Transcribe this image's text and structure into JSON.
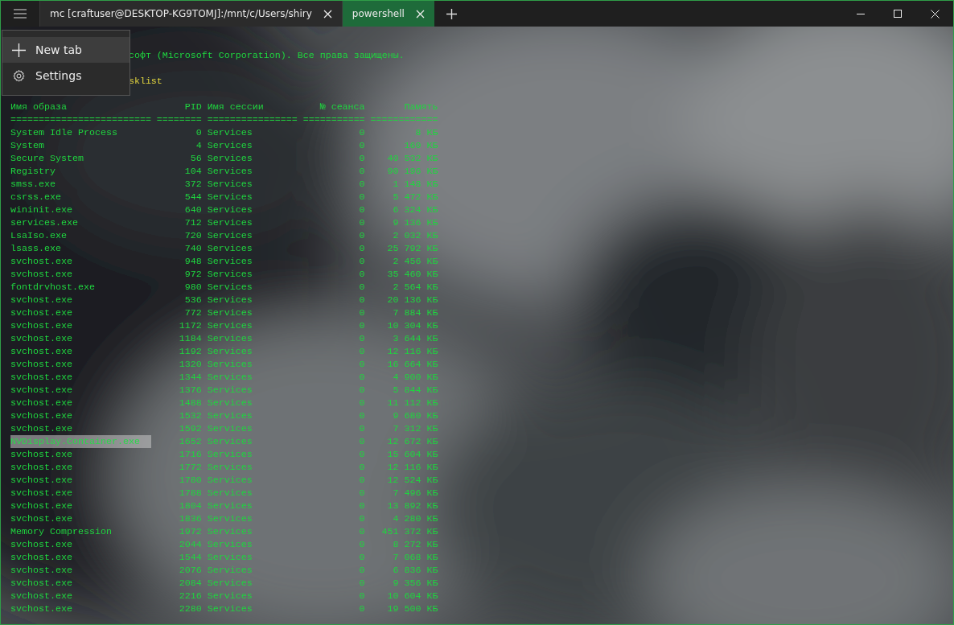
{
  "tabs": [
    {
      "title": "mc [craftuser@DESKTOP-KG9TOMJ]:/mnt/c/Users/shiry",
      "selected": false
    },
    {
      "title": "powershell",
      "selected": true
    }
  ],
  "menu": {
    "items": [
      {
        "label": "New tab",
        "kind": "new",
        "selected": true
      },
      {
        "label": "Settings",
        "kind": "settings",
        "selected": false
      }
    ]
  },
  "terminal": {
    "lines": [
      {
        "text": "софт (Microsoft Corporation). Все права защищены.",
        "kind": "output"
      },
      {
        "text": "sklist",
        "kind": "command"
      }
    ],
    "columns": [
      "Имя образа",
      "PID",
      "Имя сессии",
      "№ сеанса",
      "Память"
    ],
    "separators": [
      "=========================",
      "========",
      "================",
      "===========",
      "============"
    ],
    "rows": [
      {
        "name": "System Idle Process",
        "pid": "0",
        "session": "Services",
        "session_no": "0",
        "memory": "8 КБ",
        "selected": false
      },
      {
        "name": "System",
        "pid": "4",
        "session": "Services",
        "session_no": "0",
        "memory": "160 КБ",
        "selected": false
      },
      {
        "name": "Secure System",
        "pid": "56",
        "session": "Services",
        "session_no": "0",
        "memory": "40 532 КБ",
        "selected": false
      },
      {
        "name": "Registry",
        "pid": "104",
        "session": "Services",
        "session_no": "0",
        "memory": "90 196 КБ",
        "selected": false
      },
      {
        "name": "smss.exe",
        "pid": "372",
        "session": "Services",
        "session_no": "0",
        "memory": "1 148 КБ",
        "selected": false
      },
      {
        "name": "csrss.exe",
        "pid": "544",
        "session": "Services",
        "session_no": "0",
        "memory": "5 472 КБ",
        "selected": false
      },
      {
        "name": "wininit.exe",
        "pid": "640",
        "session": "Services",
        "session_no": "0",
        "memory": "6 324 КБ",
        "selected": false
      },
      {
        "name": "services.exe",
        "pid": "712",
        "session": "Services",
        "session_no": "0",
        "memory": "9 136 КБ",
        "selected": false
      },
      {
        "name": "LsaIso.exe",
        "pid": "720",
        "session": "Services",
        "session_no": "0",
        "memory": "2 032 КБ",
        "selected": false
      },
      {
        "name": "lsass.exe",
        "pid": "740",
        "session": "Services",
        "session_no": "0",
        "memory": "25 792 КБ",
        "selected": false
      },
      {
        "name": "svchost.exe",
        "pid": "948",
        "session": "Services",
        "session_no": "0",
        "memory": "2 456 КБ",
        "selected": false
      },
      {
        "name": "svchost.exe",
        "pid": "972",
        "session": "Services",
        "session_no": "0",
        "memory": "35 460 КБ",
        "selected": false
      },
      {
        "name": "fontdrvhost.exe",
        "pid": "980",
        "session": "Services",
        "session_no": "0",
        "memory": "2 564 КБ",
        "selected": false
      },
      {
        "name": "svchost.exe",
        "pid": "536",
        "session": "Services",
        "session_no": "0",
        "memory": "20 136 КБ",
        "selected": false
      },
      {
        "name": "svchost.exe",
        "pid": "772",
        "session": "Services",
        "session_no": "0",
        "memory": "7 884 КБ",
        "selected": false
      },
      {
        "name": "svchost.exe",
        "pid": "1172",
        "session": "Services",
        "session_no": "0",
        "memory": "10 304 КБ",
        "selected": false
      },
      {
        "name": "svchost.exe",
        "pid": "1184",
        "session": "Services",
        "session_no": "0",
        "memory": "3 644 КБ",
        "selected": false
      },
      {
        "name": "svchost.exe",
        "pid": "1192",
        "session": "Services",
        "session_no": "0",
        "memory": "12 116 КБ",
        "selected": false
      },
      {
        "name": "svchost.exe",
        "pid": "1320",
        "session": "Services",
        "session_no": "0",
        "memory": "16 664 КБ",
        "selected": false
      },
      {
        "name": "svchost.exe",
        "pid": "1344",
        "session": "Services",
        "session_no": "0",
        "memory": "4 900 КБ",
        "selected": false
      },
      {
        "name": "svchost.exe",
        "pid": "1376",
        "session": "Services",
        "session_no": "0",
        "memory": "5 844 КБ",
        "selected": false
      },
      {
        "name": "svchost.exe",
        "pid": "1488",
        "session": "Services",
        "session_no": "0",
        "memory": "11 112 КБ",
        "selected": false
      },
      {
        "name": "svchost.exe",
        "pid": "1532",
        "session": "Services",
        "session_no": "0",
        "memory": "9 680 КБ",
        "selected": false
      },
      {
        "name": "svchost.exe",
        "pid": "1592",
        "session": "Services",
        "session_no": "0",
        "memory": "7 312 КБ",
        "selected": false
      },
      {
        "name": "NVDisplay.Container.exe",
        "pid": "1652",
        "session": "Services",
        "session_no": "0",
        "memory": "12 672 КБ",
        "selected": true
      },
      {
        "name": "svchost.exe",
        "pid": "1716",
        "session": "Services",
        "session_no": "0",
        "memory": "15 604 КБ",
        "selected": false
      },
      {
        "name": "svchost.exe",
        "pid": "1772",
        "session": "Services",
        "session_no": "0",
        "memory": "12 116 КБ",
        "selected": false
      },
      {
        "name": "svchost.exe",
        "pid": "1780",
        "session": "Services",
        "session_no": "0",
        "memory": "12 524 КБ",
        "selected": false
      },
      {
        "name": "svchost.exe",
        "pid": "1788",
        "session": "Services",
        "session_no": "0",
        "memory": "7 496 КБ",
        "selected": false
      },
      {
        "name": "svchost.exe",
        "pid": "1804",
        "session": "Services",
        "session_no": "0",
        "memory": "13 892 КБ",
        "selected": false
      },
      {
        "name": "svchost.exe",
        "pid": "1836",
        "session": "Services",
        "session_no": "0",
        "memory": "4 280 КБ",
        "selected": false
      },
      {
        "name": "Memory Compression",
        "pid": "1972",
        "session": "Services",
        "session_no": "0",
        "memory": "451 372 КБ",
        "selected": false
      },
      {
        "name": "svchost.exe",
        "pid": "2044",
        "session": "Services",
        "session_no": "0",
        "memory": "8 272 КБ",
        "selected": false
      },
      {
        "name": "svchost.exe",
        "pid": "1544",
        "session": "Services",
        "session_no": "0",
        "memory": "7 068 КБ",
        "selected": false
      },
      {
        "name": "svchost.exe",
        "pid": "2076",
        "session": "Services",
        "session_no": "0",
        "memory": "6 836 КБ",
        "selected": false
      },
      {
        "name": "svchost.exe",
        "pid": "2084",
        "session": "Services",
        "session_no": "0",
        "memory": "9 356 КБ",
        "selected": false
      },
      {
        "name": "svchost.exe",
        "pid": "2216",
        "session": "Services",
        "session_no": "0",
        "memory": "10 604 КБ",
        "selected": false
      },
      {
        "name": "svchost.exe",
        "pid": "2280",
        "session": "Services",
        "session_no": "0",
        "memory": "19 500 КБ",
        "selected": false
      }
    ]
  }
}
